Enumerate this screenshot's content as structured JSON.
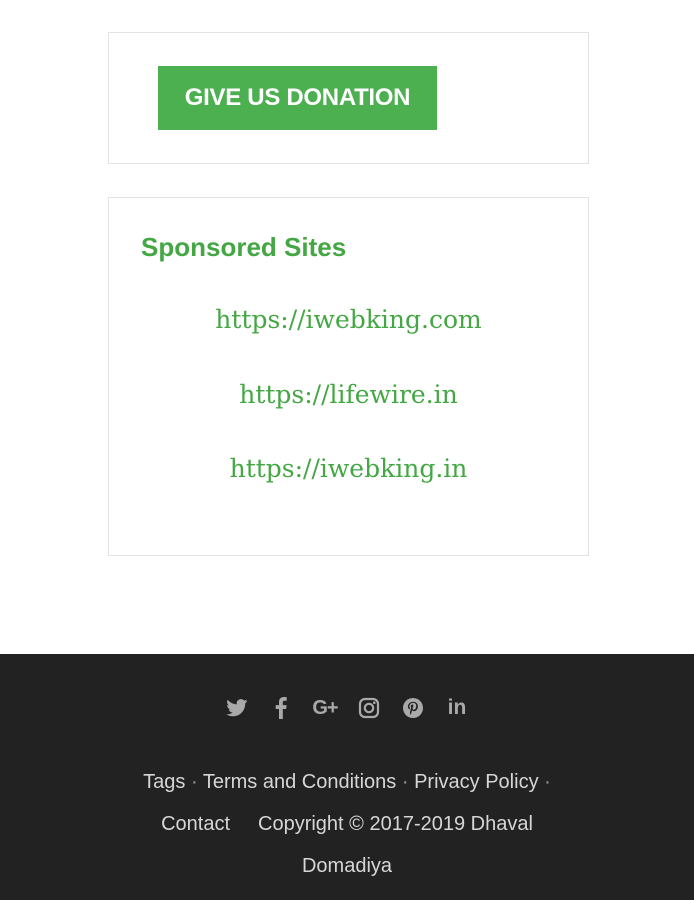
{
  "donation": {
    "button_label": "GIVE US DONATION"
  },
  "sponsored": {
    "title": "Sponsored Sites",
    "links": [
      "https://iwebking.com",
      "https://lifewire.in",
      "https://iwebking.in"
    ]
  },
  "footer": {
    "social_icons": [
      "twitter-icon",
      "facebook-icon",
      "google-plus-icon",
      "instagram-icon",
      "pinterest-icon",
      "linkedin-icon"
    ],
    "gplus_glyph": "G+",
    "linkedin_glyph": "in",
    "links": {
      "tags": "Tags",
      "terms": "Terms and Conditions",
      "privacy": "Privacy Policy",
      "contact": "Contact"
    },
    "separator": "·",
    "copyright_line1": "Copyright © 2017-2019 Dhaval",
    "copyright_line2": "Domadiya"
  },
  "colors": {
    "accent_green": "#4caf50",
    "text_green": "#44a744",
    "footer_bg": "#222222"
  }
}
